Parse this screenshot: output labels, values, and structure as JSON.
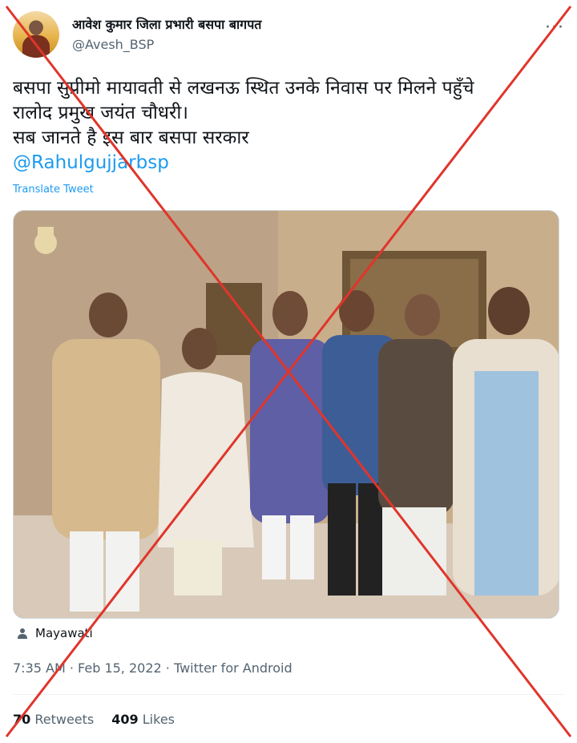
{
  "user": {
    "display_name": "आवेश कुमार जिला प्रभारी बसपा बागपत",
    "handle": "@Avesh_BSP"
  },
  "more_icon": "more-horizontal-icon",
  "tweet": {
    "lines": [
      "बसपा सुप्रीमो मायावती से लखनऊ स्थित उनके निवास पर मिलने पहुँचे",
      "रालोद प्रमुख जयंत चौधरी।",
      "सब जानते है इस बार बसपा सरकार"
    ],
    "mention": "@Rahulgujjarbsp",
    "translate_label": "Translate Tweet"
  },
  "photo_tag": {
    "icon": "person-icon",
    "name": "Mayawati"
  },
  "meta": {
    "time": "7:35 AM",
    "sep": " · ",
    "date": "Feb 15, 2022",
    "source": "Twitter for Android"
  },
  "stats": {
    "retweets_count": "70",
    "retweets_label": "Retweets",
    "likes_count": "409",
    "likes_label": "Likes"
  },
  "overlay": {
    "type": "red-cross",
    "color": "#e0352b"
  }
}
